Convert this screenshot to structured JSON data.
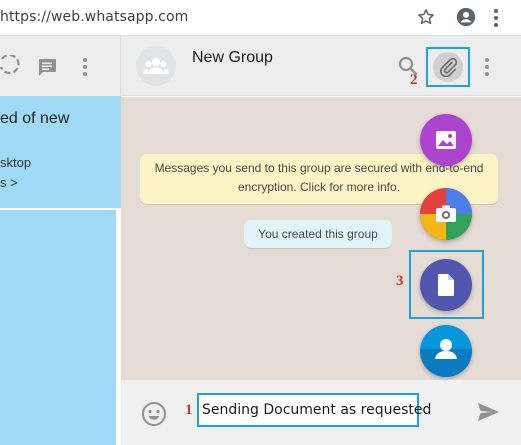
{
  "browser": {
    "url": "https://web.whatsapp.com",
    "icons": [
      "star-icon",
      "profile-icon",
      "menu-icon"
    ]
  },
  "sidebar": {
    "header_icons": [
      "status-icon",
      "chat-icon",
      "menu-icon"
    ],
    "notice": {
      "title": "ed of new",
      "line1": "sktop",
      "line2": "s >"
    }
  },
  "chat": {
    "group_name": "New Group",
    "header_icons": [
      "search-icon",
      "paperclip-icon",
      "menu-icon"
    ],
    "encryption_message": "Messages you send to this group are secured with end-to-end encryption. Click for more info.",
    "system_message": "You created this group",
    "attach_menu": [
      "gallery-icon",
      "camera-icon",
      "document-icon",
      "contact-icon"
    ]
  },
  "composer": {
    "input_value": "Sending Document as requested",
    "icons": [
      "emoji-icon",
      "send-icon"
    ]
  },
  "annotations": {
    "step1": "1",
    "step2": "2",
    "step3": "3"
  },
  "colors": {
    "highlight": "#1aa3dd",
    "annotation_text": "#c0392b",
    "notice_bg": "#9fdbf6",
    "chat_bg": "#e5ddd5",
    "encryption_bg": "#fdf4c5",
    "system_bg": "#e1f3fb",
    "gallery": "#ac44cf",
    "camera": "#d3396d",
    "document": "#5157ae",
    "contact": "#0795dc"
  }
}
